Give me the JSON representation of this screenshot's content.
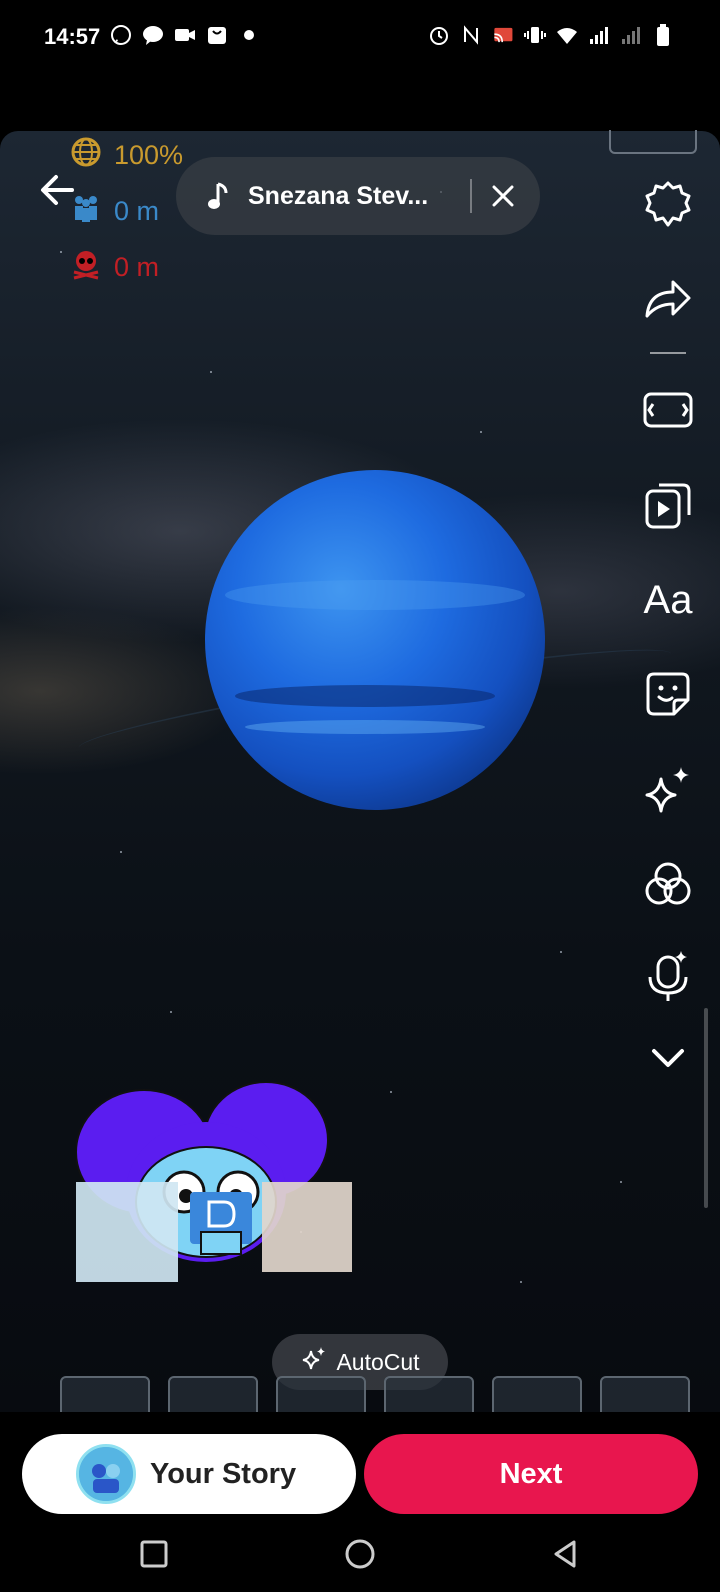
{
  "status_bar": {
    "time": "14:57",
    "left_icons": [
      "whatsapp-icon",
      "message-icon",
      "video-icon",
      "shopping-bag-icon",
      "dot-icon"
    ],
    "right_icons": [
      "alarm-icon",
      "nfc-icon",
      "cast-icon",
      "vibrate-icon",
      "wifi-icon",
      "signal-icon",
      "signal-icon",
      "battery-icon"
    ]
  },
  "hud": {
    "globe_value": "100%",
    "people_value": "0 m",
    "skull_value": "0 m"
  },
  "music": {
    "title": "Snezana Stev...",
    "icon": "music-note-icon"
  },
  "side_tools": [
    {
      "name": "settings-icon"
    },
    {
      "name": "share-arrow-icon"
    },
    {
      "name": "aspect-ratio-icon"
    },
    {
      "name": "clips-icon"
    },
    {
      "name": "text-tool",
      "label": "Aa"
    },
    {
      "name": "sticker-icon"
    },
    {
      "name": "effects-sparkle-icon"
    },
    {
      "name": "filters-icon"
    },
    {
      "name": "voice-effect-icon"
    },
    {
      "name": "chevron-down-icon"
    }
  ],
  "autocut": {
    "label": "AutoCut"
  },
  "bottom": {
    "your_story_label": "Your Story",
    "next_label": "Next"
  },
  "colors": {
    "accent_next": "#e8164e",
    "hud_gold": "#c99a2e",
    "hud_blue": "#3a89c9",
    "hud_red": "#c21f25"
  }
}
